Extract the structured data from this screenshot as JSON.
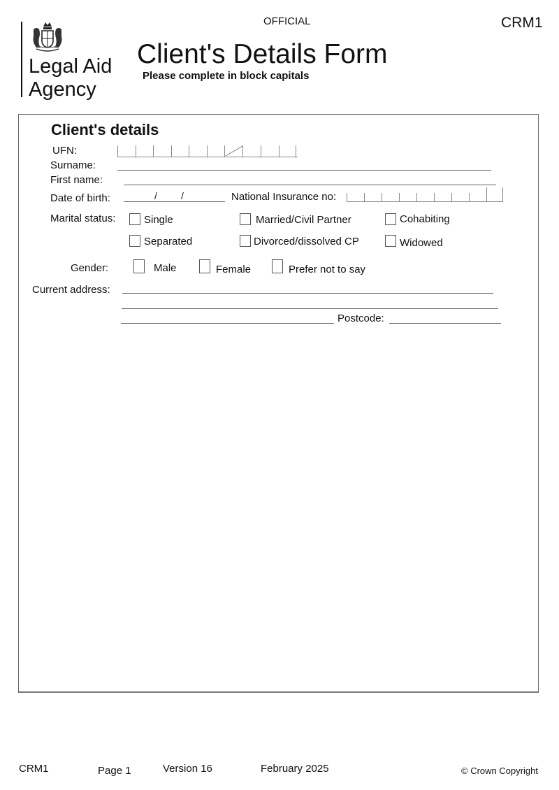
{
  "header": {
    "classification": "OFFICIAL",
    "form_code": "CRM1",
    "organisation_line1": "Legal Aid",
    "organisation_line2": "Agency",
    "title": "Client's Details Form",
    "subtitle": "Please complete in block capitals",
    "crest_icon": "royal-coat-of-arms"
  },
  "section": {
    "title": "Client's details",
    "fields": {
      "ufn_label": "UFN:",
      "surname_label": "Surname:",
      "first_name_label": "First name:",
      "dob_label": "Date of birth:",
      "dob_separator": "/",
      "ni_label": "National Insurance no:",
      "marital_label": "Marital status:",
      "gender_label": "Gender:",
      "address_label": "Current address:",
      "postcode_label": "Postcode:"
    },
    "marital_options": [
      "Single",
      "Married/Civil Partner",
      "Cohabiting",
      "Separated",
      "Divorced/dissolved CP",
      "Widowed"
    ],
    "gender_options": [
      "Male",
      "Female",
      "Prefer not to say"
    ],
    "values": {
      "ufn": "",
      "surname": "",
      "first_name": "",
      "dob": "",
      "ni": "",
      "address_line1": "",
      "address_line2": "",
      "address_line3": "",
      "postcode": ""
    }
  },
  "footer": {
    "form_code": "CRM1",
    "page": "Page 1",
    "version": "Version 16",
    "date": "February 2025",
    "copyright": "© Crown Copyright"
  }
}
